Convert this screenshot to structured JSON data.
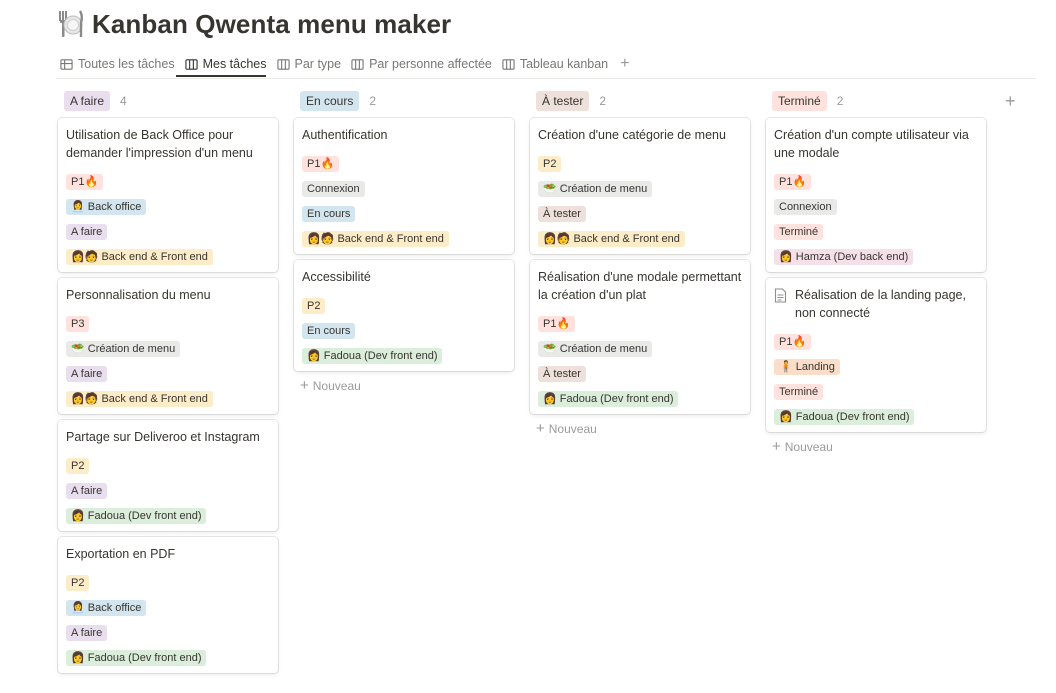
{
  "page": {
    "title": "Kanban Qwenta menu maker",
    "icon": "plate-cutlery-icon"
  },
  "tabs": [
    {
      "label": "Toutes les tâches",
      "icon": "table-icon"
    },
    {
      "label": "Mes tâches",
      "icon": "board-icon",
      "active": true
    },
    {
      "label": "Par type",
      "icon": "board-icon"
    },
    {
      "label": "Par personne affectée",
      "icon": "board-icon"
    },
    {
      "label": "Tableau kanban",
      "icon": "board-icon"
    }
  ],
  "new_label": "Nouveau",
  "columns": [
    {
      "name": "A faire",
      "count": "4",
      "color": "#e8deee",
      "cards": [
        {
          "title": "Utilisation de Back Office pour demander l'impression d'un menu",
          "tags": [
            [
              "P1🔥",
              "#ffe2dd"
            ],
            [
              "👩‍💼 Back office",
              "#d3e5ef"
            ],
            [
              "A faire",
              "#e8deee"
            ],
            [
              "👩🧑 Back end & Front end",
              "#fdecc8"
            ]
          ]
        },
        {
          "title": "Personnalisation du menu",
          "tags": [
            [
              "P3",
              "#ffe2dd"
            ],
            [
              "🥗 Création de menu",
              "#e9e9e7"
            ],
            [
              "A faire",
              "#e8deee"
            ],
            [
              "👩🧑 Back end & Front end",
              "#fdecc8"
            ]
          ]
        },
        {
          "title": "Partage sur Deliveroo et Instagram",
          "tags": [
            [
              "P2",
              "#fdecc8"
            ],
            [
              "A faire",
              "#e8deee"
            ],
            [
              "👩 Fadoua (Dev front end)",
              "#dbeddb"
            ]
          ]
        },
        {
          "title": "Exportation en PDF",
          "tags": [
            [
              "P2",
              "#fdecc8"
            ],
            [
              "👩‍💼 Back office",
              "#d3e5ef"
            ],
            [
              "A faire",
              "#e8deee"
            ],
            [
              "👩 Fadoua (Dev front end)",
              "#dbeddb"
            ]
          ]
        }
      ]
    },
    {
      "name": "En cours",
      "count": "2",
      "color": "#d3e5ef",
      "cards": [
        {
          "title": "Authentification",
          "tags": [
            [
              "P1🔥",
              "#ffe2dd"
            ],
            [
              "Connexion",
              "#e9e9e7"
            ],
            [
              "En cours",
              "#d3e5ef"
            ],
            [
              "👩🧑 Back end & Front end",
              "#fdecc8"
            ]
          ]
        },
        {
          "title": "Accessibilité",
          "tags": [
            [
              "P2",
              "#fdecc8"
            ],
            [
              "En cours",
              "#d3e5ef"
            ],
            [
              "👩 Fadoua (Dev front end)",
              "#dbeddb"
            ]
          ]
        }
      ]
    },
    {
      "name": "À tester",
      "count": "2",
      "color": "#eee0da",
      "cards": [
        {
          "title": "Création d'une catégorie de menu",
          "tags": [
            [
              "P2",
              "#fdecc8"
            ],
            [
              "🥗 Création de menu",
              "#e9e9e7"
            ],
            [
              "À tester",
              "#eee0da"
            ],
            [
              "👩🧑 Back end & Front end",
              "#fdecc8"
            ]
          ]
        },
        {
          "title": "Réalisation d'une modale permettant la création d'un plat",
          "tags": [
            [
              "P1🔥",
              "#ffe2dd"
            ],
            [
              "🥗 Création de menu",
              "#e9e9e7"
            ],
            [
              "À tester",
              "#eee0da"
            ],
            [
              "👩 Fadoua (Dev front end)",
              "#dbeddb"
            ]
          ]
        }
      ]
    },
    {
      "name": "Terminé",
      "count": "2",
      "color": "#ffe2dd",
      "cards": [
        {
          "title": "Création d'un compte utilisateur via une modale",
          "tags": [
            [
              "P1🔥",
              "#ffe2dd"
            ],
            [
              "Connexion",
              "#e9e9e7"
            ],
            [
              "Terminé",
              "#ffe2dd"
            ],
            [
              "👩 Hamza (Dev back end)",
              "#f5e0e9"
            ]
          ]
        },
        {
          "title": "Réalisation de la landing page, non connecté",
          "doc": true,
          "tags": [
            [
              "P1🔥",
              "#ffe2dd"
            ],
            [
              "🧍 Landing",
              "#fadec9"
            ],
            [
              "Terminé",
              "#ffe2dd"
            ],
            [
              "👩 Fadoua (Dev front end)",
              "#dbeddb"
            ]
          ]
        }
      ]
    }
  ]
}
